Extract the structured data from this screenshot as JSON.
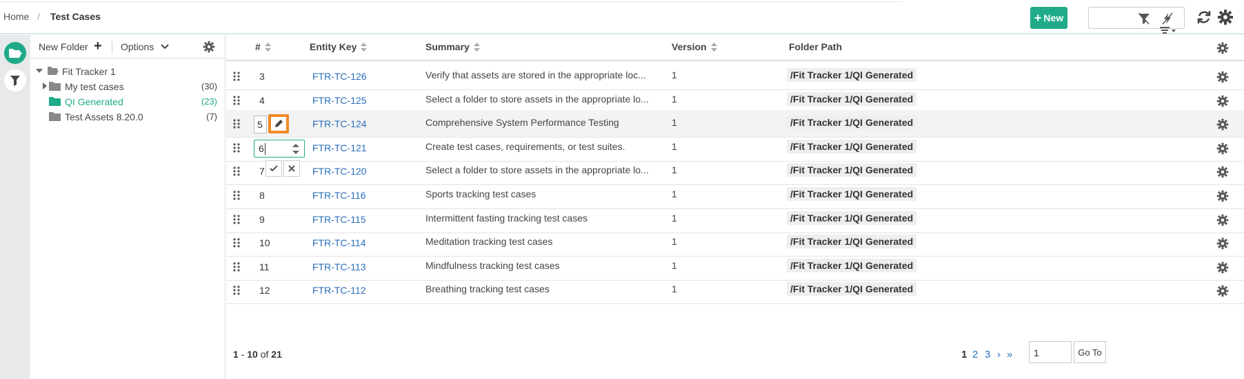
{
  "breadcrumb": {
    "home": "Home",
    "separator": "/",
    "current": "Test Cases"
  },
  "toolbar": {
    "new_label": "New"
  },
  "folders": {
    "new_folder_label": "New Folder",
    "options_label": "Options",
    "root": "Fit Tracker 1",
    "items": [
      {
        "label": "My test cases",
        "count": "(30)"
      },
      {
        "label": "QI Generated",
        "count": "(23)"
      },
      {
        "label": "Test Assets 8.20.0",
        "count": "(7)"
      }
    ]
  },
  "grid": {
    "columns": {
      "num": "#",
      "key": "Entity Key",
      "summary": "Summary",
      "version": "Version",
      "path": "Folder Path"
    },
    "rows": [
      {
        "num": "3",
        "key": "FTR-TC-126",
        "summary": "Verify that assets are stored in the appropriate loc...",
        "version": "1",
        "path": "/Fit Tracker 1/QI Generated"
      },
      {
        "num": "4",
        "key": "FTR-TC-125",
        "summary": "Select a folder to store assets in the appropriate lo...",
        "version": "1",
        "path": "/Fit Tracker 1/QI Generated"
      },
      {
        "num": "5",
        "key": "FTR-TC-124",
        "summary": "Comprehensive System Performance Testing",
        "version": "1",
        "path": "/Fit Tracker 1/QI Generated"
      },
      {
        "num": "6",
        "key": "FTR-TC-121",
        "summary": "Create test cases, requirements, or test suites.",
        "version": "1",
        "path": "/Fit Tracker 1/QI Generated"
      },
      {
        "num": "7",
        "key": "FTR-TC-120",
        "summary": "Select a folder to store assets in the appropriate lo...",
        "version": "1",
        "path": "/Fit Tracker 1/QI Generated"
      },
      {
        "num": "8",
        "key": "FTR-TC-116",
        "summary": "Sports tracking test cases",
        "version": "1",
        "path": "/Fit Tracker 1/QI Generated"
      },
      {
        "num": "9",
        "key": "FTR-TC-115",
        "summary": "Intermittent fasting tracking test cases",
        "version": "1",
        "path": "/Fit Tracker 1/QI Generated"
      },
      {
        "num": "10",
        "key": "FTR-TC-114",
        "summary": "Meditation tracking test cases",
        "version": "1",
        "path": "/Fit Tracker 1/QI Generated"
      },
      {
        "num": "11",
        "key": "FTR-TC-113",
        "summary": "Mindfulness tracking test cases",
        "version": "1",
        "path": "/Fit Tracker 1/QI Generated"
      },
      {
        "num": "12",
        "key": "FTR-TC-112",
        "summary": "Breathing tracking test cases",
        "version": "1",
        "path": "/Fit Tracker 1/QI Generated"
      }
    ],
    "edit_value": "6"
  },
  "pagination": {
    "range_start": "1",
    "range_sep": "-",
    "range_end": "10",
    "of": "of",
    "total": "21",
    "pages": [
      "1",
      "2",
      "3"
    ],
    "next": "›",
    "last": "»",
    "goto_value": "1",
    "goto_label": "Go To"
  },
  "colors": {
    "accent": "#1fab89",
    "link": "#2a6ebb",
    "edit": "#f08a24"
  }
}
